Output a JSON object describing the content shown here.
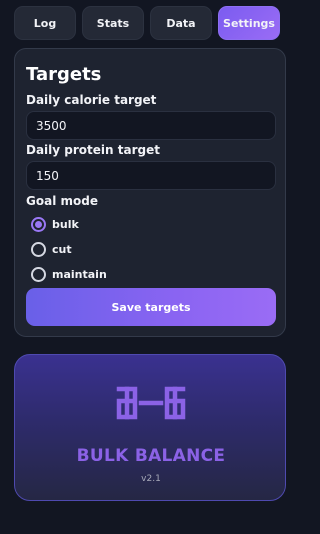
{
  "tabs": [
    {
      "label": "Log",
      "active": false
    },
    {
      "label": "Stats",
      "active": false
    },
    {
      "label": "Data",
      "active": false
    },
    {
      "label": "Settings",
      "active": true
    }
  ],
  "targets": {
    "title": "Targets",
    "calorie_label": "Daily calorie target",
    "calorie_value": "3500",
    "protein_label": "Daily protein target",
    "protein_value": "150",
    "goal_label": "Goal mode",
    "goal_options": [
      "bulk",
      "cut",
      "maintain"
    ],
    "goal_selected": "bulk",
    "save_label": "Save targets"
  },
  "brand": {
    "logo_icon": "bulk-balance-logo-icon",
    "name": "BULK BALANCE",
    "version": "v2.1"
  },
  "colors": {
    "accent": "#8d6ff2",
    "background": "#121622",
    "card": "#1e2330",
    "brand_text": "#8b62e6"
  }
}
